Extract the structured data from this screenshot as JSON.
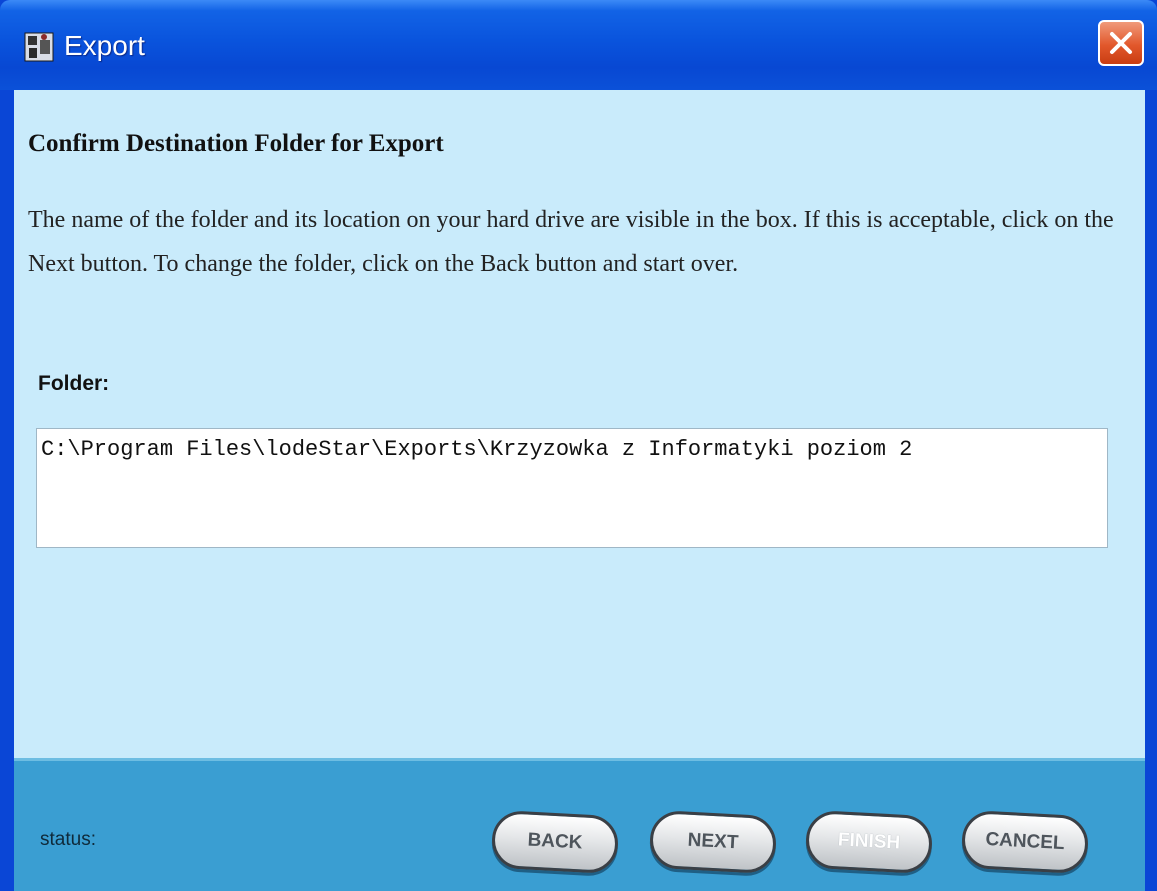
{
  "window": {
    "title": "Export"
  },
  "content": {
    "heading": "Confirm Destination Folder for Export",
    "paragraph": "The name of the folder and its location on your hard drive are visible in the box.  If this is acceptable, click on the Next button.  To change the folder, click on the Back button and start over.",
    "folder_label": "Folder:",
    "folder_path": "C:\\Program Files\\lodeStar\\Exports\\Krzyzowka z Informatyki poziom 2"
  },
  "footer": {
    "status_label": "status:",
    "buttons": {
      "back": "BACK",
      "next": "NEXT",
      "finish": "FINISH",
      "cancel": "CANCEL"
    }
  },
  "icons": {
    "app": "app-icon",
    "close": "close-icon"
  },
  "colors": {
    "titlebar": "#0a54dd",
    "content_bg": "#c9ebfb",
    "footer_bg": "#3a9ed2",
    "close_button": "#e2582c"
  }
}
